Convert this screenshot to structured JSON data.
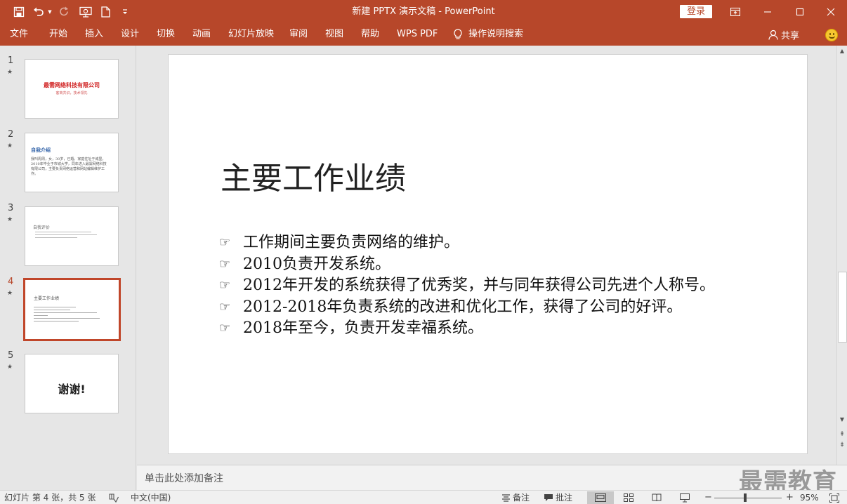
{
  "title_bar": {
    "document_title": "新建 PPTX 演示文稿 - PowerPoint",
    "login_label": "登录",
    "quick_access_icons": [
      "save-icon",
      "undo-icon",
      "undo-dropdown-icon",
      "redo-icon",
      "present-from-start-icon",
      "new-document-icon",
      "customize-toolbar-icon"
    ],
    "window_controls": [
      "ribbon-display-options-icon",
      "minimize-icon",
      "maximize-icon",
      "close-icon"
    ]
  },
  "menu": {
    "tabs": [
      "文件",
      "开始",
      "插入",
      "设计",
      "切换",
      "动画",
      "幻灯片放映",
      "审阅",
      "视图",
      "帮助",
      "WPS PDF"
    ],
    "tell_me": "操作说明搜索",
    "share": "共享"
  },
  "thumbnails": [
    {
      "number": "1",
      "title": "最需网络科技有限公司",
      "subtitle": "客商共识，技术领先"
    },
    {
      "number": "2",
      "title": "自我介绍",
      "body": "我叫周周，女，30岁，已婚，家庭住址于城里。2010年毕业于市城大学，同年进入最需网络科技有限公司，主要负责网络运营和网站编辑维护工作。"
    },
    {
      "number": "3",
      "title": "自我评价"
    },
    {
      "number": "4",
      "title": "主要工作业绩"
    },
    {
      "number": "5",
      "title": "谢谢!"
    }
  ],
  "active_slide_index": 4,
  "slide": {
    "title": "主要工作业绩",
    "bullets": [
      "工作期间主要负责网络的维护。",
      "2010负责开发系统。",
      "2012年开发的系统获得了优秀奖，并与同年获得公司先进个人称号。",
      "2012-2018年负责系统的改进和优化工作，获得了公司的好评。",
      "2018年至今，负责开发幸福系统。"
    ],
    "bullet_icon": "☞"
  },
  "notes_placeholder": "单击此处添加备注",
  "watermark": "最需教育",
  "status_bar": {
    "slide_info": "幻灯片 第 4 张，共 5 张",
    "language": "中文(中国)",
    "notes_label": "备注",
    "comments_label": "批注",
    "zoom_minus": "−",
    "zoom_plus": "+",
    "zoom": "95%"
  },
  "colors": {
    "accent": "#b7472a",
    "title_red": "#d02020",
    "heading_blue": "#2d5fa6"
  }
}
